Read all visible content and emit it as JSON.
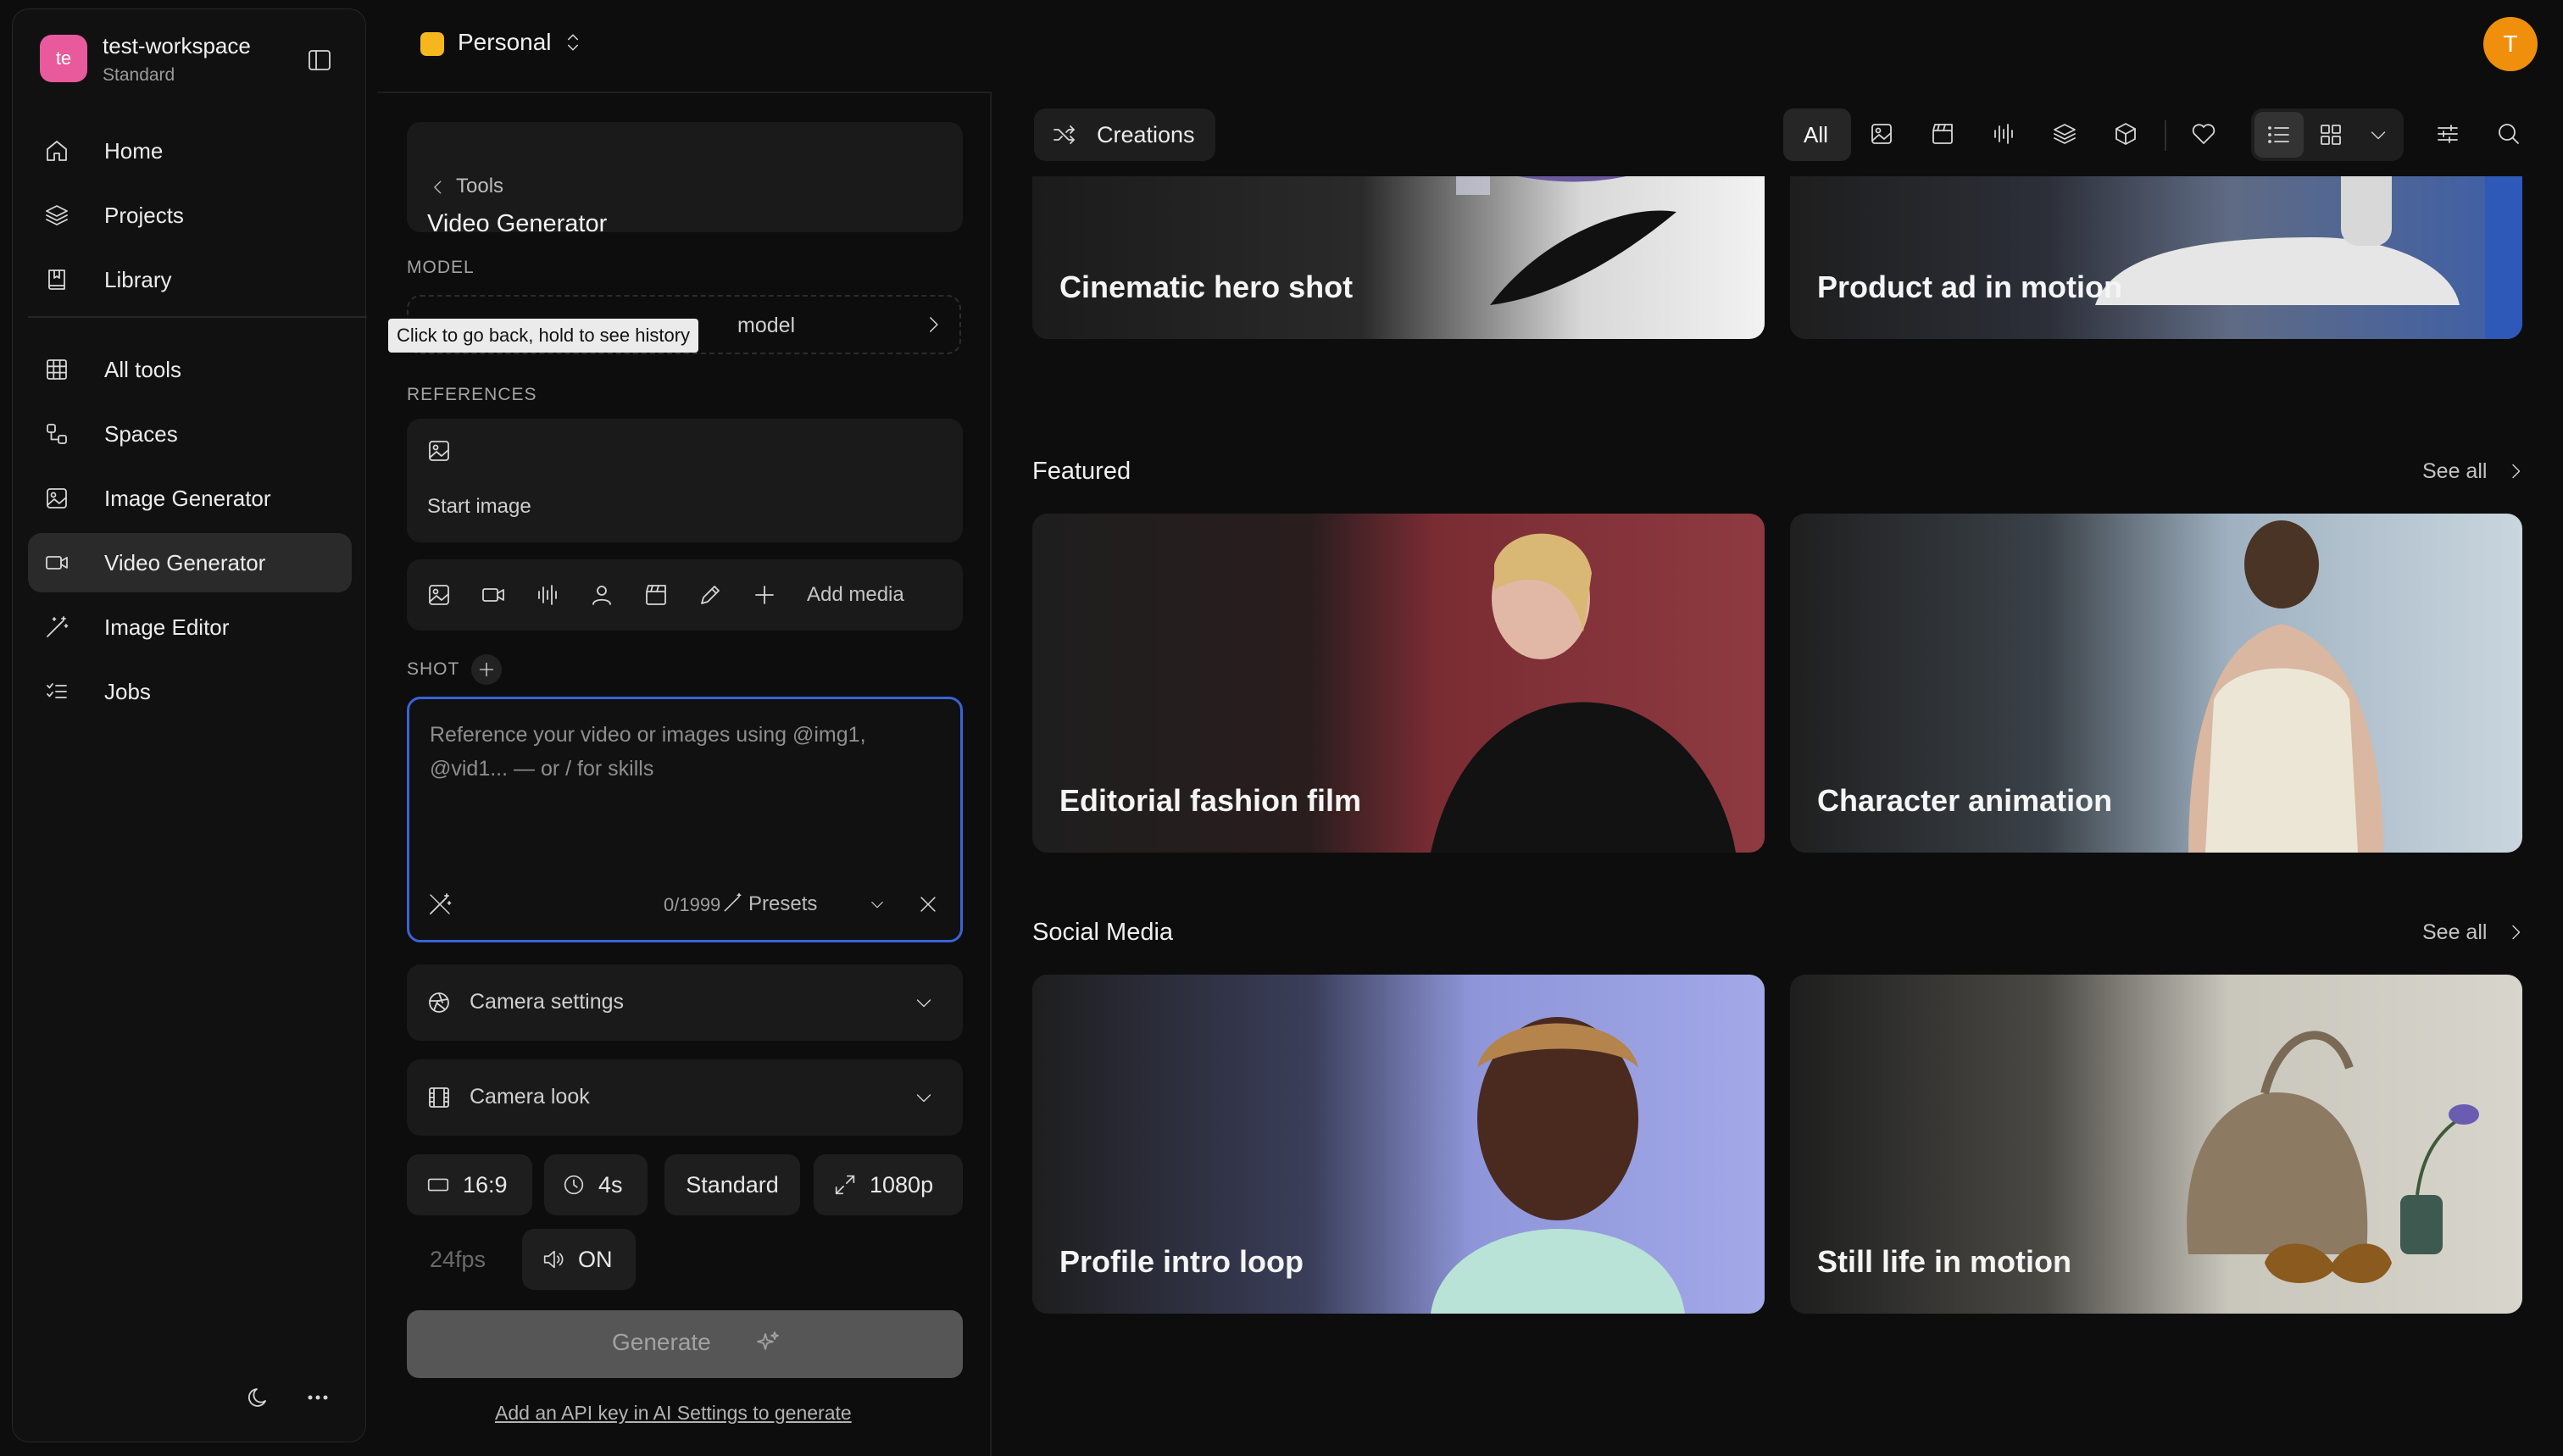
{
  "workspace": {
    "initials": "te",
    "name": "test-workspace",
    "plan": "Standard"
  },
  "sidebar": {
    "items": [
      {
        "label": "Home",
        "icon": "home-icon"
      },
      {
        "label": "Projects",
        "icon": "layers-icon"
      },
      {
        "label": "Library",
        "icon": "book-icon"
      },
      {
        "label": "All tools",
        "icon": "grid-icon"
      },
      {
        "label": "Spaces",
        "icon": "spaces-icon"
      },
      {
        "label": "Image Generator",
        "icon": "image-icon"
      },
      {
        "label": "Video Generator",
        "icon": "video-icon"
      },
      {
        "label": "Image Editor",
        "icon": "magic-wand-icon"
      },
      {
        "label": "Jobs",
        "icon": "checklist-icon"
      }
    ],
    "active": "Video Generator"
  },
  "topbar": {
    "space": "Personal",
    "user_initial": "T"
  },
  "panel": {
    "back_label": "Tools",
    "title": "Video Generator",
    "model_label": "MODEL",
    "model_value": "model",
    "tooltip": "Click to go back, hold to see history",
    "references_label": "REFERENCES",
    "start_image_label": "Start image",
    "add_media_label": "Add media",
    "shot_label": "SHOT",
    "prompt_placeholder": "Reference your video or images using @img1, @vid1... — or / for skills",
    "char_count": "0/1999",
    "presets_label": "Presets",
    "camera_settings_label": "Camera settings",
    "camera_look_label": "Camera look",
    "aspect_ratio": "16:9",
    "duration": "4s",
    "quality": "Standard",
    "resolution": "1080p",
    "fps": "24fps",
    "audio": "ON",
    "generate_label": "Generate",
    "api_key_notice": "Add an API key in AI Settings to generate"
  },
  "filters": {
    "creations_label": "Creations",
    "all_label": "All"
  },
  "content": {
    "top_row": [
      {
        "title": "Cinematic hero shot"
      },
      {
        "title": "Product ad in motion"
      }
    ],
    "sections": [
      {
        "heading": "Featured",
        "see_all": "See all",
        "cards": [
          {
            "title": "Editorial fashion film"
          },
          {
            "title": "Character animation"
          }
        ]
      },
      {
        "heading": "Social Media",
        "see_all": "See all",
        "cards": [
          {
            "title": "Profile intro loop"
          },
          {
            "title": "Still life in motion"
          }
        ]
      }
    ]
  },
  "colors": {
    "accent": "#3a63d9",
    "workspace_badge": "#e85a9c",
    "personal_badge": "#f5b71b",
    "user_avatar": "#f08f0c"
  }
}
